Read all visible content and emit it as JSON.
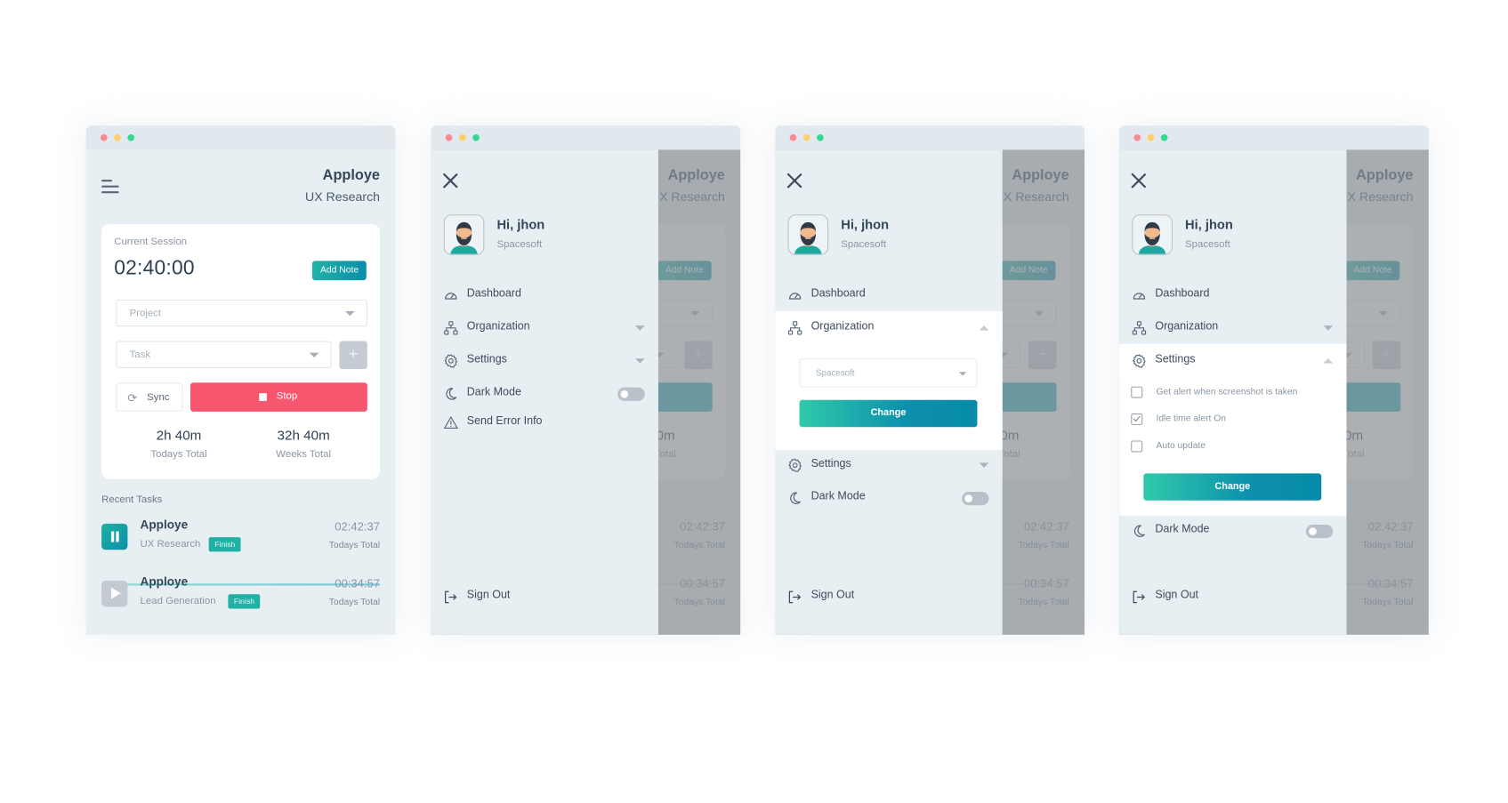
{
  "app": {
    "name": "Apploye",
    "project": "UX Research"
  },
  "window_controls": [
    "close",
    "minimize",
    "maximize"
  ],
  "session": {
    "label": "Current Session",
    "timer": "02:40:00",
    "add_note_label": "Add Note",
    "project_placeholder": "Project",
    "task_placeholder": "Task",
    "add_task_label": "+",
    "sync_label": "Sync",
    "stop_label": "Stop",
    "todays_total_value": "2h 40m",
    "todays_total_label": "Todays Total",
    "weeks_total_value": "32h 40m",
    "weeks_total_label": "Weeks Total"
  },
  "recent_tasks": {
    "label": "Recent Tasks",
    "items": [
      {
        "name": "Apploye",
        "project": "UX Research",
        "badge": "Finish",
        "time": "02:42:37",
        "time_label": "Todays Total",
        "state": "running",
        "icon": "pause-icon"
      },
      {
        "name": "Apploye",
        "project": "Lead Generation",
        "badge": "Finish",
        "time": "00:34:57",
        "time_label": "Todays Total",
        "state": "paused",
        "icon": "play-icon"
      }
    ]
  },
  "drawer": {
    "greeting": "Hi, jhon",
    "company": "Spacesoft",
    "menu": [
      {
        "label": "Dashboard",
        "icon": "dashboard-gauge-icon"
      },
      {
        "label": "Organization",
        "icon": "organization-icon"
      },
      {
        "label": "Settings",
        "icon": "gear-icon"
      },
      {
        "label": "Dark Mode",
        "icon": "moon-icon",
        "toggle": false
      },
      {
        "label": "Send Error Info",
        "icon": "warning-icon"
      }
    ],
    "sign_out_label": "Sign Out",
    "organization_select_value": "Spacesoft",
    "change_label": "Change",
    "settings_options": [
      {
        "label": "Get alert when screenshot is taken",
        "checked": false
      },
      {
        "label": "Idle time alert On",
        "checked": true
      },
      {
        "label": "Auto update",
        "checked": false
      }
    ]
  },
  "colors": {
    "accent_teal": "#1fb1a4",
    "stop_red": "#f7566f",
    "panel_bg": "#e8eff3"
  }
}
